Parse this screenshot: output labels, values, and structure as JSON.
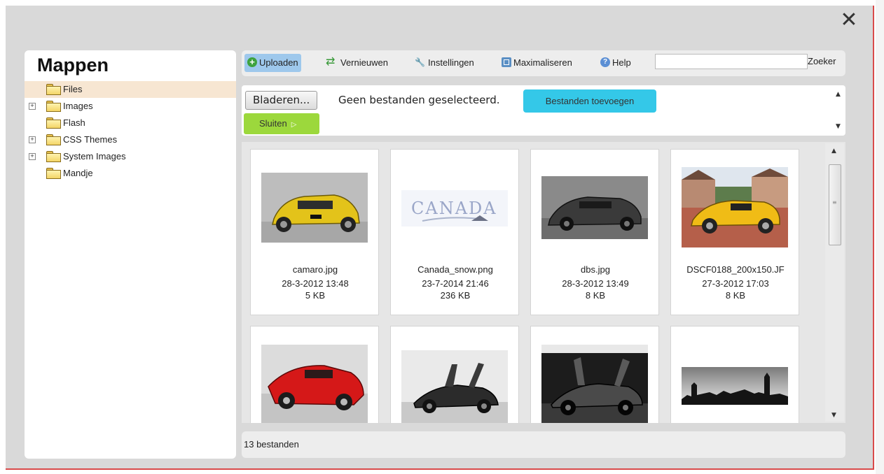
{
  "dialog": {
    "close_glyph": "✕"
  },
  "sidebar": {
    "title": "Mappen",
    "folders": [
      {
        "label": "Files",
        "expandable": false,
        "selected": true
      },
      {
        "label": "Images",
        "expandable": true,
        "selected": false
      },
      {
        "label": "Flash",
        "expandable": false,
        "selected": false
      },
      {
        "label": "CSS Themes",
        "expandable": true,
        "selected": false
      },
      {
        "label": "System Images",
        "expandable": true,
        "selected": false
      },
      {
        "label": "Mandje",
        "expandable": false,
        "selected": false
      }
    ],
    "expander_glyph": "+"
  },
  "toolbar": {
    "upload_label": "Uploaden",
    "refresh_label": "Vernieuwen",
    "settings_label": "Instellingen",
    "maximize_label": "Maximaliseren",
    "help_label": "Help",
    "search_value": "",
    "search_label": "Zoeker"
  },
  "upload": {
    "browse_label": "Bladeren...",
    "no_files_text": "Geen bestanden geselecteerd.",
    "add_files_label": "Bestanden toevoegen",
    "close_label": "Sluiten",
    "close_arrow": "▷"
  },
  "files": [
    {
      "name": "camaro.jpg",
      "date": "28-3-2012 13:48",
      "size": "5 KB"
    },
    {
      "name": "Canada_snow.png",
      "date": "23-7-2014 21:46",
      "size": "236 KB"
    },
    {
      "name": "dbs.jpg",
      "date": "28-3-2012 13:49",
      "size": "8 KB"
    },
    {
      "name": "DSCF0188_200x150.JF",
      "date": "27-3-2012 17:03",
      "size": "8 KB"
    },
    {
      "name": "",
      "date": "",
      "size": ""
    },
    {
      "name": "",
      "date": "",
      "size": ""
    },
    {
      "name": "",
      "date": "",
      "size": ""
    },
    {
      "name": "",
      "date": "",
      "size": ""
    }
  ],
  "canada_text": "CANADA",
  "status": {
    "count_text": "13 bestanden"
  },
  "colors": {
    "accent": "#9ec8ec",
    "add_button": "#34c8e8",
    "close_button": "#9cd83c",
    "dialog_border": "#d94a4a"
  }
}
